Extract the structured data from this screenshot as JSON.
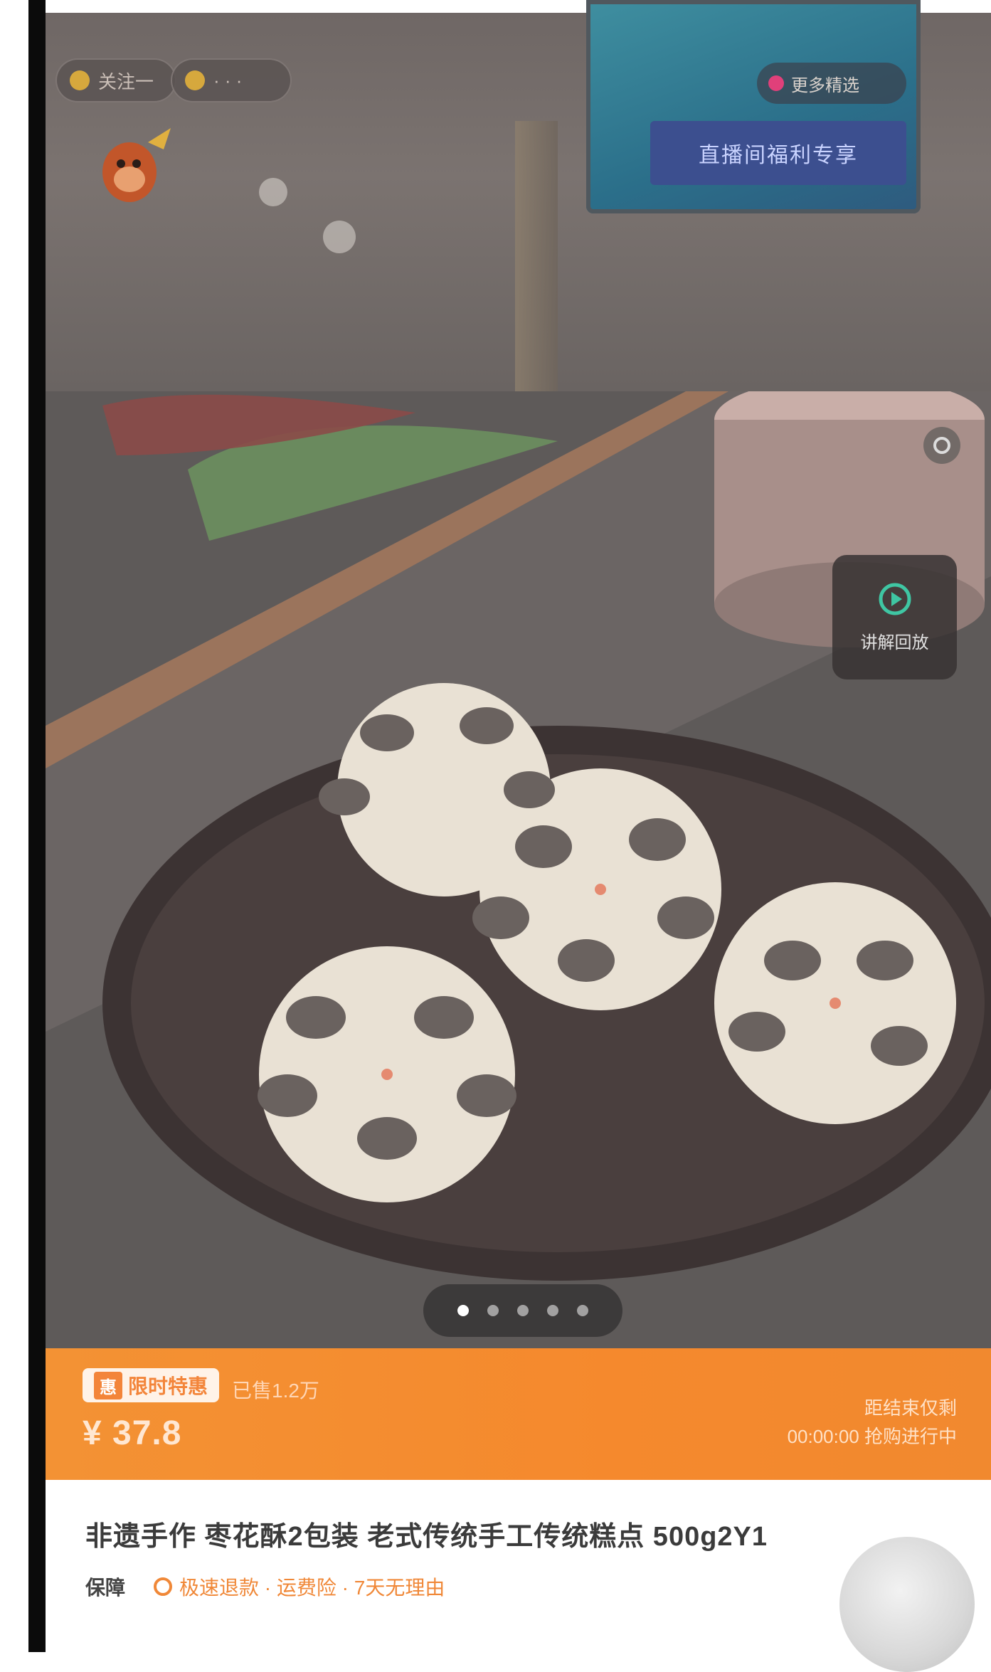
{
  "live": {
    "chips": [
      {
        "label": "关注一"
      },
      {
        "label": "· · ·"
      }
    ],
    "tv_banner": "直播间福利专享",
    "tv_tag": "更多精选"
  },
  "gallery": {
    "total_pages": 5,
    "current_page": 1,
    "service_label": "讲解回放"
  },
  "price_banner": {
    "badge_mark": "惠",
    "badge_text": "限时特惠",
    "sub_note": "已售1.2万",
    "price": "¥ 37.8",
    "right_line1": "距结束仅剩",
    "right_line2": "00:00:00 抢购进行中"
  },
  "product": {
    "title": "非遗手作 枣花酥2包装 老式传统手工传统糕点 500g2Y1",
    "shipping_label": "保障",
    "shipping_value": "极速退款 · 运费险 · 7天无理由"
  },
  "colors": {
    "accent": "#f39234",
    "price_text": "#ffe7d2",
    "edge": "#0b0b0b"
  }
}
